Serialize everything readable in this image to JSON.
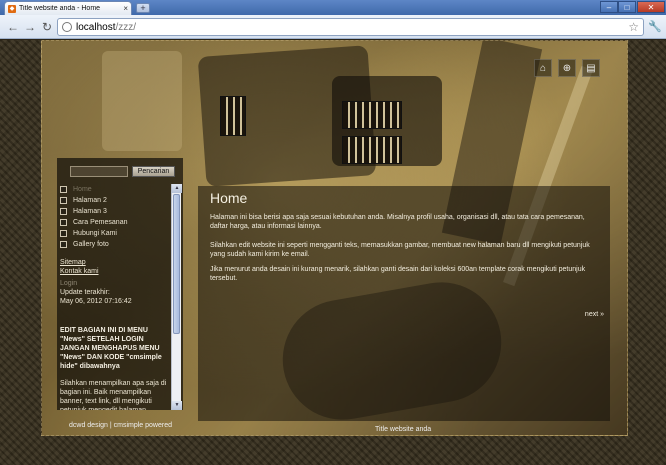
{
  "browser": {
    "tab_title": "Title website anda - Home",
    "tab_close": "×",
    "new_tab": "+",
    "address_host": "localhost",
    "address_path": "/zzz/",
    "nav_back": "←",
    "nav_forward": "→",
    "nav_reload": "↻",
    "star": "☆",
    "wrench": "🔧",
    "win_min": "–",
    "win_max": "□",
    "win_close": "✕"
  },
  "site": {
    "search_button": "Pencarian",
    "menu": [
      "Home",
      "Halaman 2",
      "Halaman 3",
      "Cara Pemesanan",
      "Hubungi Kami",
      "Gallery foto"
    ],
    "links": {
      "sitemap": "Sitemap",
      "contact": "Kontak kami",
      "login": "Login",
      "updated_label": "Update terakhir:",
      "updated_value": "May 06, 2012 07:16:42"
    },
    "sidebar_heading": "EDIT BAGIAN INI DI MENU \"News\" SETELAH LOGIN JANGAN MENGHAPUS MENU \"News\" DAN KODE \"cmsimple hide\" dibawahnya",
    "sidebar_text": "Silahkan menampilkan apa saja di bagian ini. Baik menampilkan banner, text link, dll mengikuti petunjuk mengedit halaman caranya",
    "content_title": "Home",
    "paragraphs": [
      "Halaman ini bisa berisi apa saja sesuai kebutuhan anda. Misalnya profil usaha, organisasi dll, atau tata cara pemesanan, daftar harga, atau informasi lainnya.",
      "Silahkan edit website ini seperti mengganti teks, memasukkan gambar, membuat new halaman baru dll mengikuti petunjuk yang sudah kami kirim ke email.",
      "Jika menurut anda desain ini kurang menarik, silahkan ganti desain dari koleksi 600an template corak mengikuti petunjuk tersebut."
    ],
    "next_link": "next »",
    "footer_left": "dcwd design | cmsimple powered",
    "footer_right": "Title website anda",
    "top_icons": [
      "home-icon",
      "sitemap-icon",
      "print-icon"
    ]
  }
}
